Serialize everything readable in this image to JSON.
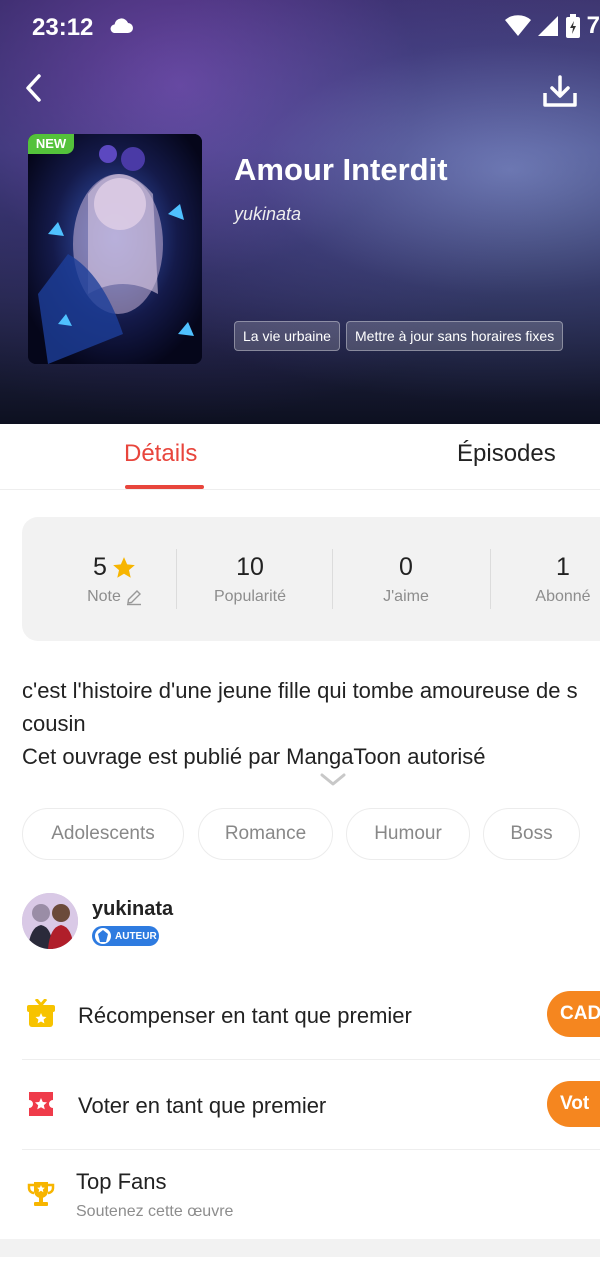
{
  "status_bar": {
    "time": "23:12",
    "battery_text": "7"
  },
  "book": {
    "badge": "NEW",
    "title": "Amour Interdit",
    "author": "yukinata",
    "genres": [
      "La vie urbaine",
      "Mettre à jour sans horaires fixes"
    ]
  },
  "tabs": {
    "details": "Détails",
    "episodes": "Épisodes"
  },
  "stats": {
    "rating": {
      "value": "5",
      "label": "Note"
    },
    "popularity": {
      "value": "10",
      "label": "Popularité"
    },
    "likes": {
      "value": "0",
      "label": "J'aime"
    },
    "subscribers": {
      "value": "1",
      "label": "Abonné"
    }
  },
  "description": {
    "line1": "c'est l'histoire d'une jeune fille qui tombe amoureuse de s",
    "line2": "cousin",
    "line3": "Cet ouvrage est publié par MangaToon  autorisé"
  },
  "tags": [
    "Adolescents",
    "Romance",
    "Humour",
    "Boss"
  ],
  "author_section": {
    "name": "yukinata",
    "badge": "AUTEUR"
  },
  "actions": {
    "reward": {
      "label": "Récompenser en tant que premier",
      "button": "CADE"
    },
    "vote": {
      "label": "Voter en tant que premier",
      "button": "Vot"
    },
    "top_fans": {
      "label": "Top Fans",
      "subtitle": "Soutenez cette œuvre"
    }
  },
  "colors": {
    "accent_red": "#e8453c",
    "button_orange": "#f5861f",
    "new_badge_green": "#54c23b",
    "author_badge_blue": "#2e7be0"
  }
}
